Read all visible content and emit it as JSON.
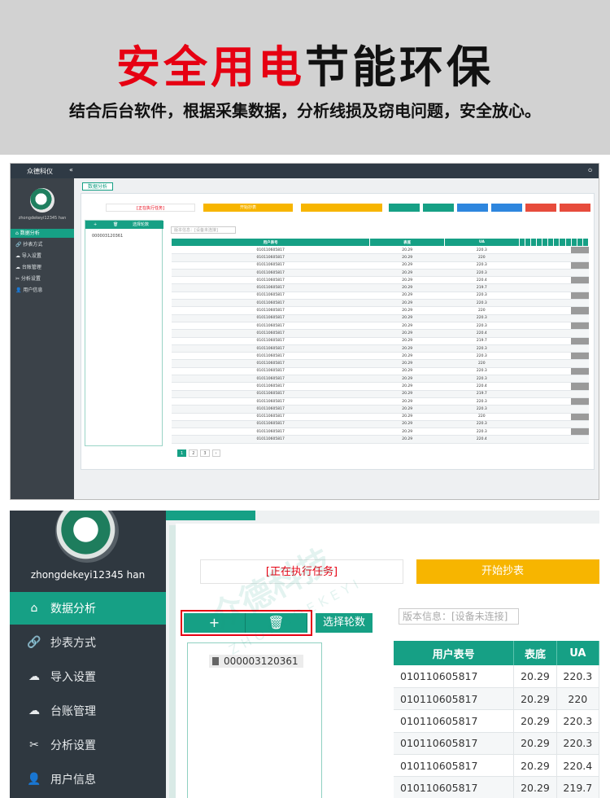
{
  "banner": {
    "headline_red": "安全用电",
    "headline_black": "节能环保",
    "subtitle": "结合后台软件，根据采集数据，分析线损及窃电问题，安全放心。"
  },
  "watermark": {
    "text": "众德科技",
    "sub": "ZHONGDEKEYI"
  },
  "app": {
    "brand": "众德科仪",
    "collapse_icon": "«",
    "user_name": "zhongdekeyi12345 han",
    "sidebar": [
      {
        "label": "数据分析",
        "icon": "home-icon"
      },
      {
        "label": "抄表方式",
        "icon": "link-icon"
      },
      {
        "label": "导入设置",
        "icon": "cloud-upload-icon"
      },
      {
        "label": "台账管理",
        "icon": "cloud-sync-icon"
      },
      {
        "label": "分析设置",
        "icon": "tools-icon"
      },
      {
        "label": "用户信息",
        "icon": "user-icon"
      }
    ],
    "sidebar_glyphs": [
      "⌂",
      "🔗",
      "☁",
      "☁",
      "✂",
      "👤"
    ],
    "tab_label": "数据分析",
    "task_status": "[正在执行任务]",
    "start_button": "开始抄表",
    "add_button": "+",
    "delete_button": "🗑",
    "select_rounds": "选择轮数",
    "version_info": "版本信息：[设备未连接]",
    "tree_node": "000003120361",
    "table": {
      "columns": [
        "用户表号",
        "表底",
        "UA"
      ],
      "rows": [
        [
          "010110605817",
          "20.29",
          "220.3"
        ],
        [
          "010110605817",
          "20.29",
          "220"
        ],
        [
          "010110605817",
          "20.29",
          "220.3"
        ],
        [
          "010110605817",
          "20.29",
          "220.3"
        ],
        [
          "010110605817",
          "20.29",
          "220.4"
        ],
        [
          "010110605817",
          "20.29",
          "219.7"
        ],
        [
          "010110605817",
          "20.29",
          "220.3"
        ]
      ]
    }
  }
}
